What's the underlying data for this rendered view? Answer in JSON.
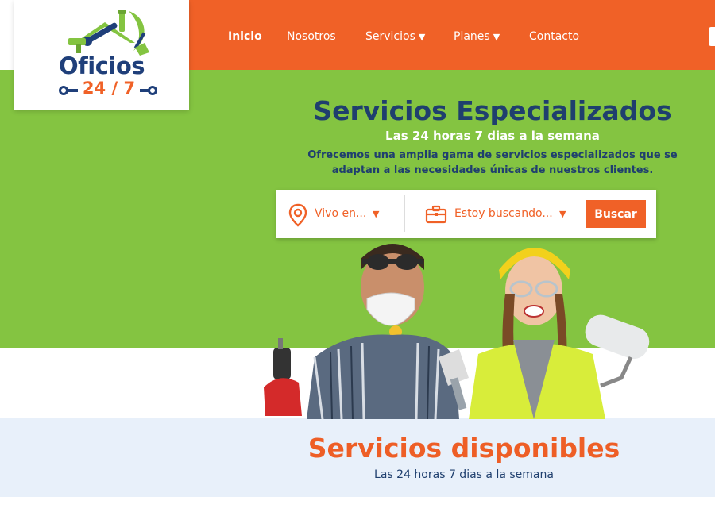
{
  "brand": {
    "name": "Oficios",
    "tagline": "24 / 7"
  },
  "nav": {
    "items": [
      {
        "label": "Inicio",
        "active": true
      },
      {
        "label": "Nosotros"
      },
      {
        "label": "Servicios",
        "dropdown": true
      },
      {
        "label": "Planes",
        "dropdown": true
      },
      {
        "label": "Contacto"
      }
    ]
  },
  "hero": {
    "title": "Servicios Especializados",
    "subtitle": "Las 24 horas 7 dias a la semana",
    "description": "Ofrecemos una amplia gama de servicios especializados que se adaptan a las necesidades únicas de nuestros clientes."
  },
  "search": {
    "location_placeholder": "Vivo en...",
    "service_placeholder": "Estoy buscando...",
    "button_label": "Buscar"
  },
  "services": {
    "title": "Servicios disponibles",
    "subtitle": "Las 24 horas 7 dias a la semana"
  },
  "colors": {
    "orange": "#f06127",
    "green": "#84c441",
    "navy": "#1f3f6e",
    "light_blue": "#e8f0fa"
  },
  "icons": [
    "location-pin-icon",
    "briefcase-icon",
    "caret-down-icon"
  ]
}
